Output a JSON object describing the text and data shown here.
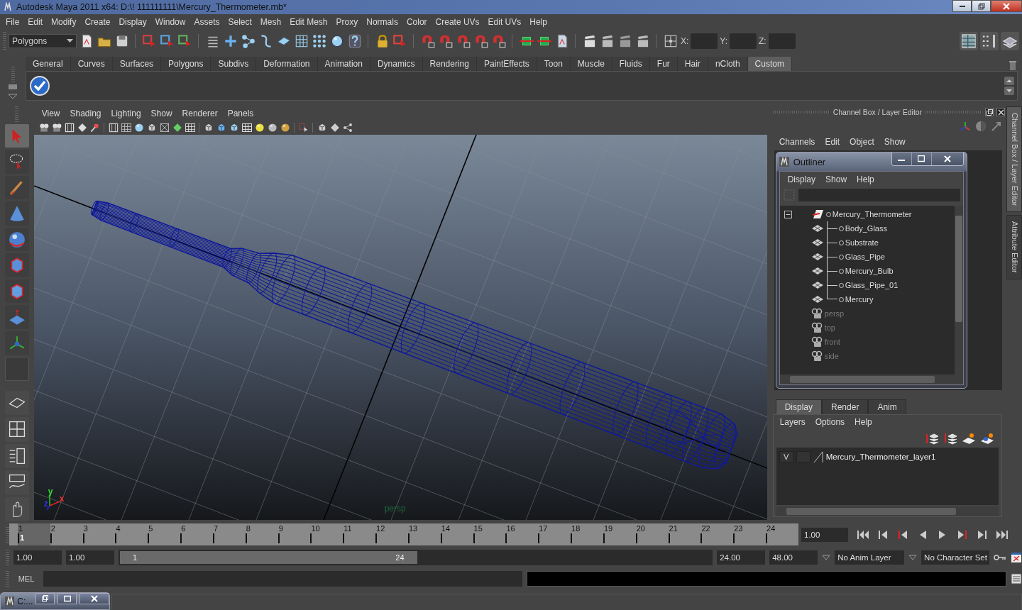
{
  "window": {
    "title": "Autodesk Maya 2011 x64: D:\\! 111111111\\Mercury_Thermometer.mb*"
  },
  "menu_bar": [
    "File",
    "Edit",
    "Modify",
    "Create",
    "Display",
    "Window",
    "Assets",
    "Select",
    "Mesh",
    "Edit Mesh",
    "Proxy",
    "Normals",
    "Color",
    "Create UVs",
    "Edit UVs",
    "Help"
  ],
  "status_line": {
    "mode": "Polygons",
    "coordinate_labels": [
      "X:",
      "Y:",
      "Z:"
    ]
  },
  "shelf": {
    "tabs": [
      {
        "label": "General",
        "selected": false
      },
      {
        "label": "Curves",
        "selected": false
      },
      {
        "label": "Surfaces",
        "selected": false
      },
      {
        "label": "Polygons",
        "selected": false
      },
      {
        "label": "Subdivs",
        "selected": false
      },
      {
        "label": "Deformation",
        "selected": false
      },
      {
        "label": "Animation",
        "selected": false
      },
      {
        "label": "Dynamics",
        "selected": false
      },
      {
        "label": "Rendering",
        "selected": false
      },
      {
        "label": "PaintEffects",
        "selected": false
      },
      {
        "label": "Toon",
        "selected": false
      },
      {
        "label": "Muscle",
        "selected": false
      },
      {
        "label": "Fluids",
        "selected": false
      },
      {
        "label": "Fur",
        "selected": false
      },
      {
        "label": "Hair",
        "selected": false
      },
      {
        "label": "nCloth",
        "selected": false
      },
      {
        "label": "Custom",
        "selected": true
      }
    ]
  },
  "viewport": {
    "menu": [
      "View",
      "Shading",
      "Lighting",
      "Show",
      "Renderer",
      "Panels"
    ],
    "camera_label": "persp",
    "axis_labels": [
      "y",
      "z",
      "x"
    ]
  },
  "channel_box": {
    "title": "Channel Box / Layer Editor",
    "menu": [
      "Channels",
      "Edit",
      "Object",
      "Show"
    ]
  },
  "outliner": {
    "title": "Outliner",
    "menu": [
      "Display",
      "Show",
      "Help"
    ],
    "items": [
      {
        "label": "Mercury_Thermometer",
        "kind": "group",
        "expanded": true,
        "children": [
          {
            "label": "Body_Glass",
            "kind": "mesh"
          },
          {
            "label": "Substrate",
            "kind": "mesh"
          },
          {
            "label": "Glass_Pipe",
            "kind": "mesh"
          },
          {
            "label": "Mercury_Bulb",
            "kind": "mesh"
          },
          {
            "label": "Glass_Pipe_01",
            "kind": "mesh"
          },
          {
            "label": "Mercury",
            "kind": "mesh"
          }
        ]
      },
      {
        "label": "persp",
        "kind": "camera"
      },
      {
        "label": "top",
        "kind": "camera"
      },
      {
        "label": "front",
        "kind": "camera"
      },
      {
        "label": "side",
        "kind": "camera"
      }
    ]
  },
  "layer_editor": {
    "tabs": [
      {
        "label": "Display",
        "selected": true
      },
      {
        "label": "Render",
        "selected": false
      },
      {
        "label": "Anim",
        "selected": false
      }
    ],
    "menu": [
      "Layers",
      "Options",
      "Help"
    ],
    "layers": [
      {
        "visibility": "V",
        "name": "Mercury_Thermometer_layer1"
      }
    ]
  },
  "timeline": {
    "frames": [
      {
        "label": "1",
        "selected": true
      },
      {
        "label": "2",
        "selected": false
      },
      {
        "label": "3",
        "selected": false
      },
      {
        "label": "4",
        "selected": false
      },
      {
        "label": "5",
        "selected": false
      },
      {
        "label": "6",
        "selected": false
      },
      {
        "label": "7",
        "selected": false
      },
      {
        "label": "8",
        "selected": false
      },
      {
        "label": "9",
        "selected": false
      },
      {
        "label": "10",
        "selected": false
      },
      {
        "label": "11",
        "selected": false
      },
      {
        "label": "12",
        "selected": false
      },
      {
        "label": "13",
        "selected": false
      },
      {
        "label": "14",
        "selected": false
      },
      {
        "label": "15",
        "selected": false
      },
      {
        "label": "16",
        "selected": false
      },
      {
        "label": "17",
        "selected": false
      },
      {
        "label": "18",
        "selected": false
      },
      {
        "label": "19",
        "selected": false
      },
      {
        "label": "20",
        "selected": false
      },
      {
        "label": "21",
        "selected": false
      },
      {
        "label": "22",
        "selected": false
      },
      {
        "label": "23",
        "selected": false
      },
      {
        "label": "24",
        "selected": false
      }
    ],
    "current_frame": "1",
    "current_time": "1.00"
  },
  "range_slider": {
    "level": 0.5,
    "start_time": "1.00",
    "playback_start": "1.00",
    "range_start": "1",
    "range_end": "24",
    "playback_end": "24.00",
    "end_time": "48.00",
    "anim_layer": "No Anim Layer",
    "character_set": "No Character Set"
  },
  "command_line": {
    "language": "MEL"
  },
  "side_tabs": [
    {
      "label": "Channel Box / Layer Editor",
      "selected": true
    },
    {
      "label": "Attribute Editor",
      "selected": false
    }
  ],
  "minimized_window": {
    "title": "C:..."
  }
}
